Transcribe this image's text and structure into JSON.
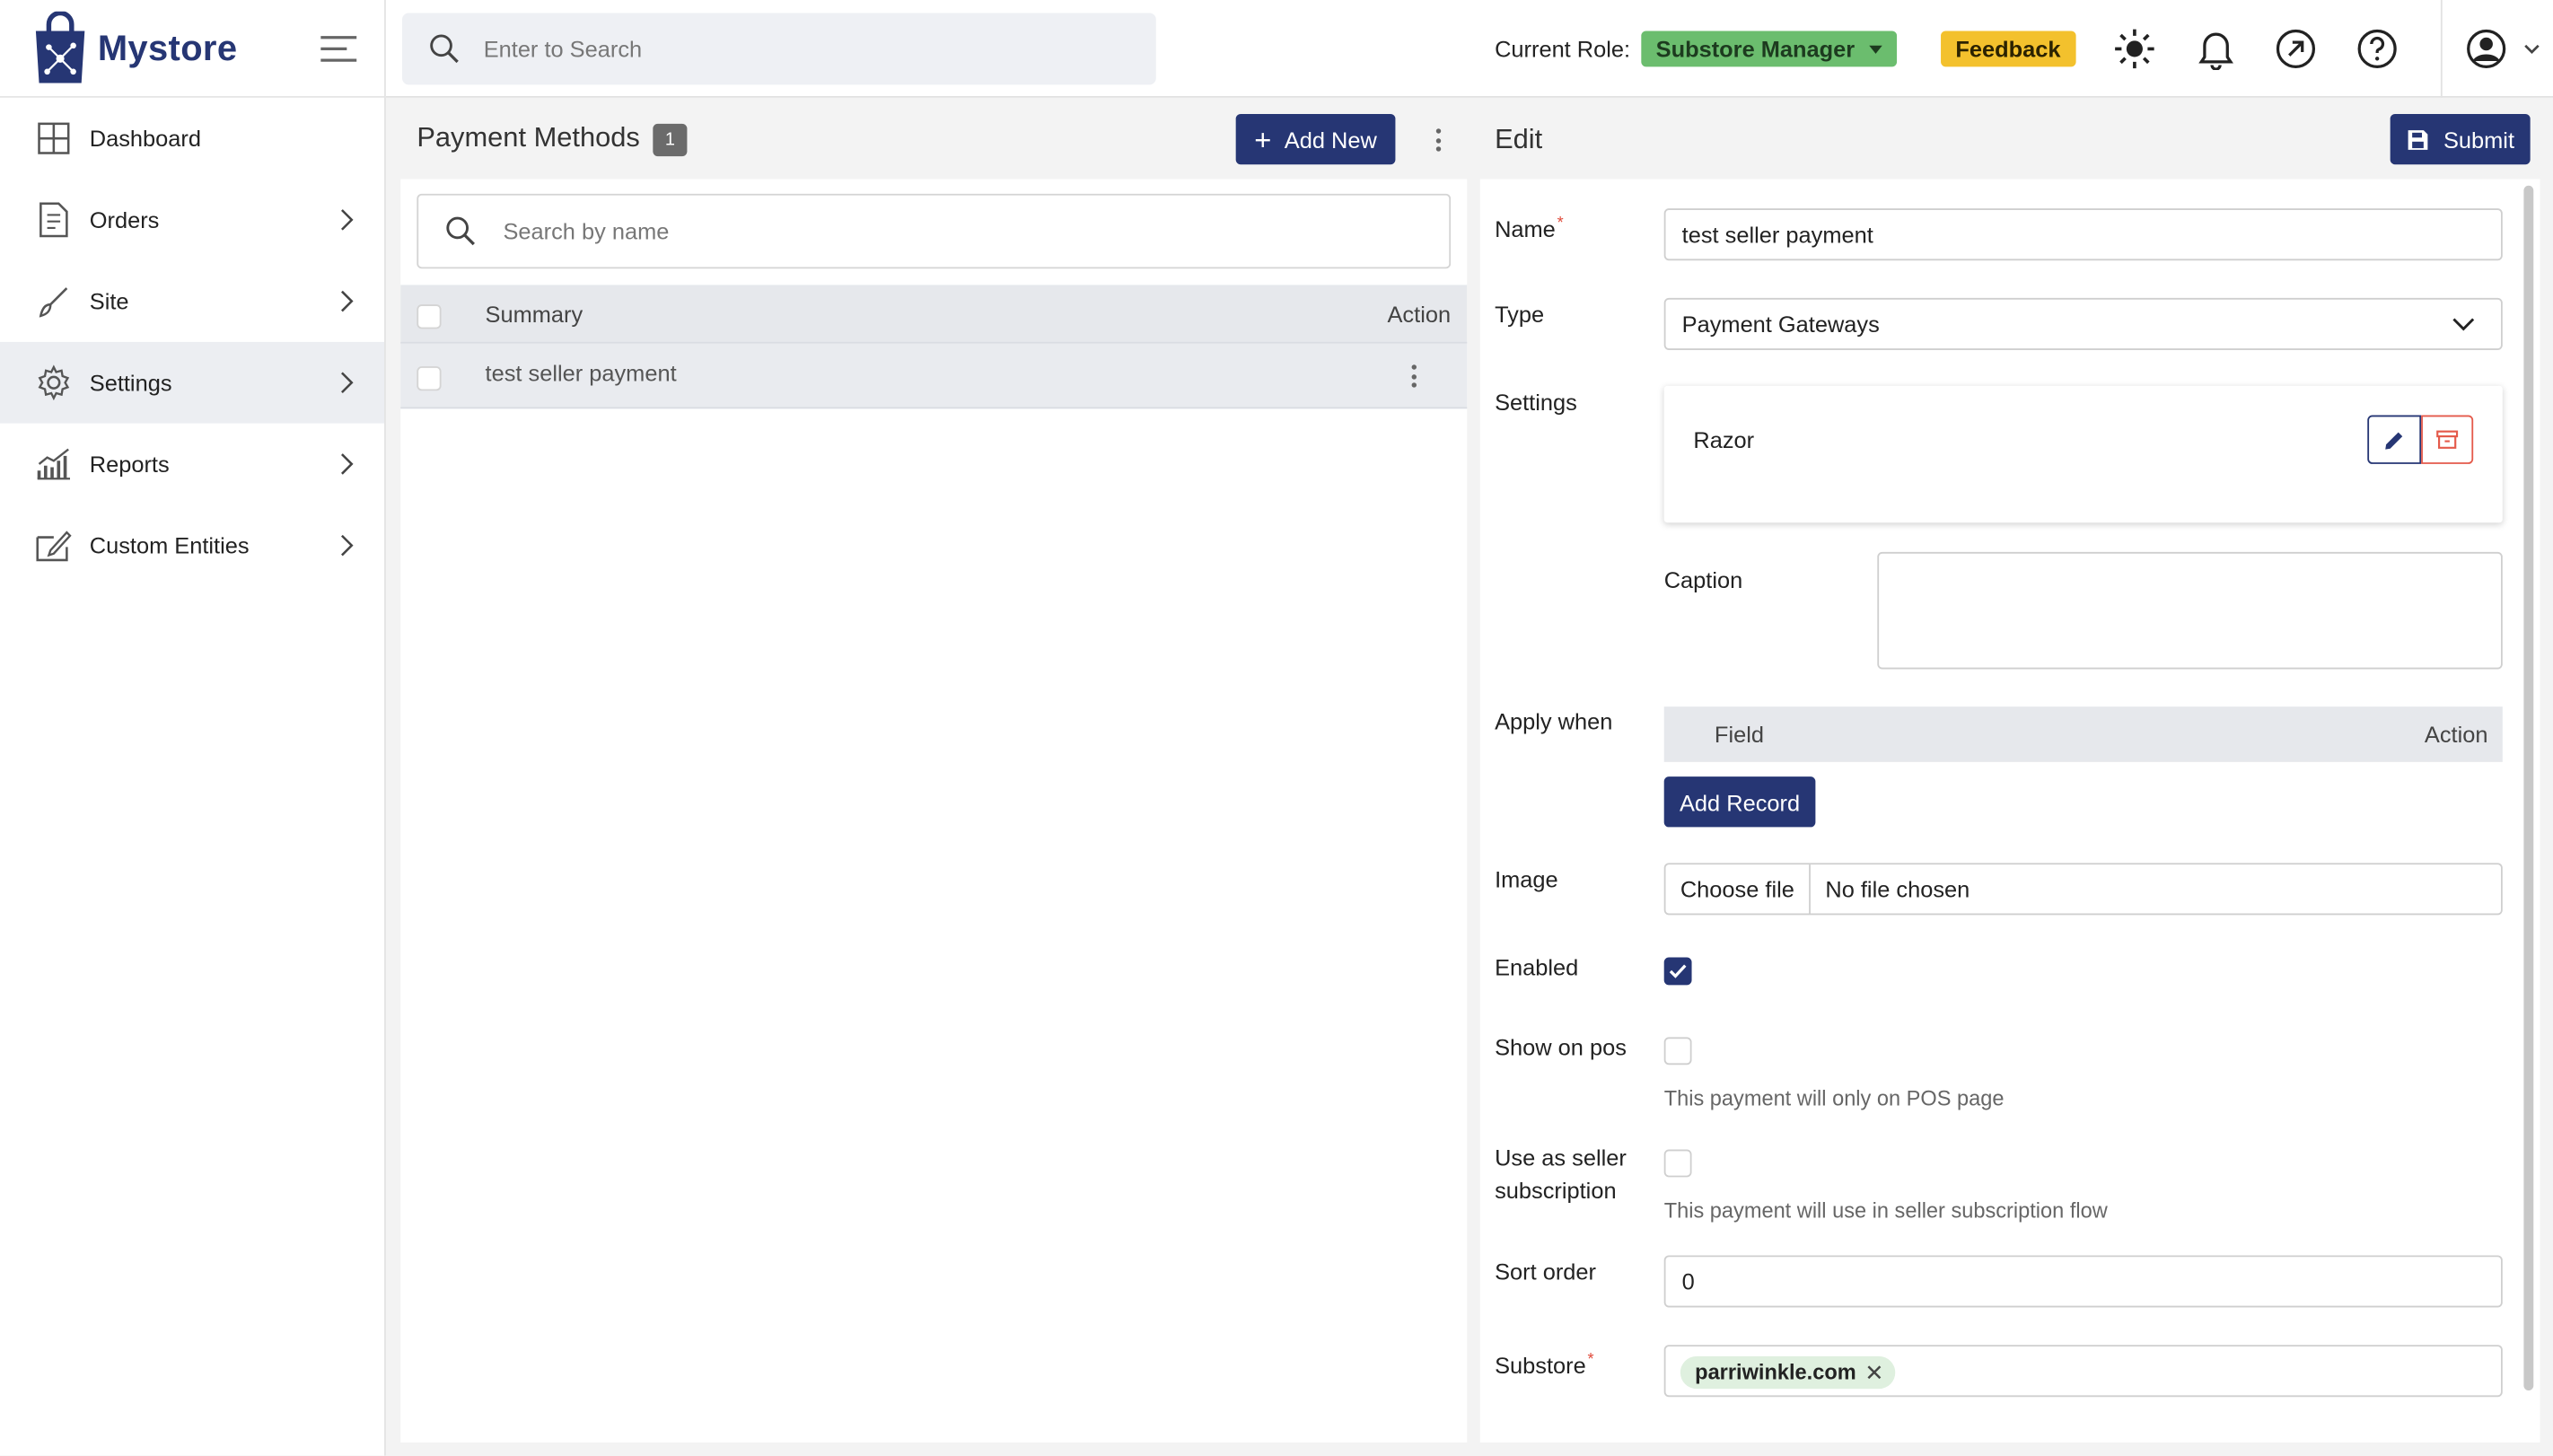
{
  "brand": {
    "name": "Mystore"
  },
  "sidebar": {
    "items": [
      {
        "label": "Dashboard",
        "icon": "dashboard-icon",
        "has_submenu": false,
        "active": false
      },
      {
        "label": "Orders",
        "icon": "orders-icon",
        "has_submenu": true,
        "active": false
      },
      {
        "label": "Site",
        "icon": "brush-icon",
        "has_submenu": true,
        "active": false
      },
      {
        "label": "Settings",
        "icon": "gear-icon",
        "has_submenu": true,
        "active": true
      },
      {
        "label": "Reports",
        "icon": "chart-icon",
        "has_submenu": true,
        "active": false
      },
      {
        "label": "Custom Entities",
        "icon": "edit-box-icon",
        "has_submenu": true,
        "active": false
      }
    ]
  },
  "topbar": {
    "search_placeholder": "Enter to Search",
    "role_label": "Current Role:",
    "role_value": "Substore Manager",
    "feedback_label": "Feedback",
    "icons": [
      "sun-icon",
      "bell-icon",
      "external-link-icon",
      "help-icon",
      "user-avatar-icon"
    ]
  },
  "list": {
    "title": "Payment Methods",
    "count": "1",
    "add_label": "Add New",
    "search_placeholder": "Search by name",
    "columns": {
      "summary": "Summary",
      "action": "Action"
    },
    "rows": [
      {
        "summary": "test seller payment"
      }
    ]
  },
  "edit": {
    "title": "Edit",
    "submit_label": "Submit",
    "fields": {
      "name_label": "Name",
      "name_value": "test seller payment",
      "type_label": "Type",
      "type_value": "Payment Gateways",
      "settings_label": "Settings",
      "settings_item": "Razor",
      "caption_label": "Caption",
      "caption_value": "",
      "apply_label": "Apply when",
      "apply_col_field": "Field",
      "apply_col_action": "Action",
      "add_record_label": "Add Record",
      "image_label": "Image",
      "choose_file_label": "Choose file",
      "no_file_label": "No file chosen",
      "enabled_label": "Enabled",
      "enabled_value": true,
      "show_pos_label": "Show on pos",
      "show_pos_value": false,
      "show_pos_hint": "This payment will only on POS page",
      "seller_sub_label_1": "Use as seller",
      "seller_sub_label_2": "subscription",
      "seller_sub_value": false,
      "seller_sub_hint": "This payment will use in seller subscription flow",
      "sort_label": "Sort order",
      "sort_value": "0",
      "substore_label": "Substore",
      "substore_value": "parriwinkle.com"
    }
  },
  "colors": {
    "primary": "#263674",
    "role_badge": "#6bbd6e",
    "feedback": "#f3c12d",
    "required": "#e04a3a",
    "chip": "#dff0df"
  }
}
